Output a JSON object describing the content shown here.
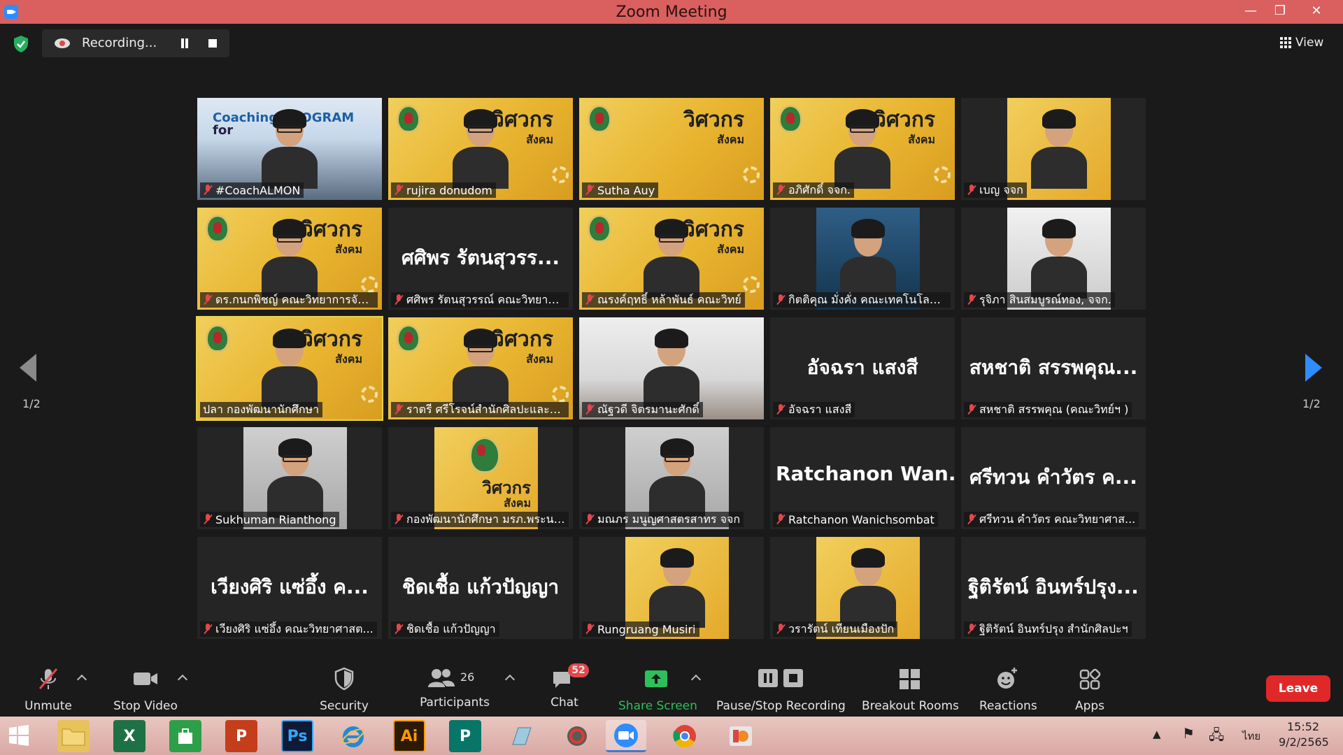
{
  "window": {
    "title": "Zoom Meeting",
    "min": "—",
    "max": "❐",
    "close": "✕"
  },
  "topbar": {
    "recording_label": "Recording...",
    "view_label": "View"
  },
  "pages": {
    "left": "1/2",
    "right": "1/2"
  },
  "participants": [
    {
      "name": "#CoachALMON",
      "style": "coach"
    },
    {
      "name": "rujira donudom",
      "style": "yellow-person"
    },
    {
      "name": "Sutha Auy",
      "style": "yellow"
    },
    {
      "name": "อภิศักดิ์ จจก.",
      "style": "yellow-person"
    },
    {
      "name": "เบญ จจก",
      "style": "inset-person"
    },
    {
      "name": "ดร.กนกพิชญ์ คณะวิทยาการจัด...",
      "style": "yellow-person"
    },
    {
      "name": "ศศิพร รัตนสุวรรณ์ คณะวิทยาศ...",
      "style": "text",
      "display": "ศศิพร รัตนสุวรร..."
    },
    {
      "name": "ณรงค์ฤทธิ์ หล้าพันธ์ คณะวิทย์",
      "style": "yellow-person"
    },
    {
      "name": "กิตติคุณ มั่งคั่ง คณะเทคโนโลยีอุ...",
      "style": "inset-blue"
    },
    {
      "name": "รุจิภา สินสมบูรณ์ทอง, จจก.",
      "style": "inset-girl"
    },
    {
      "name": "ปลา กองพัฒนานักศึกษา",
      "style": "yellow-person",
      "active": true
    },
    {
      "name": "ราตรี  ศรีโรจน์สำนักศิลปะและวั...",
      "style": "yellow-person"
    },
    {
      "name": "ณัฐวดี จิตรมานะศักดิ์",
      "style": "office"
    },
    {
      "name": "อัจฉรา แสงสี",
      "style": "text",
      "display": "อัจฉรา แสงสี"
    },
    {
      "name": "สหชาติ สรรพคุณ (คณะวิทย์ฯ )",
      "style": "text",
      "display": "สหชาติ สรรพคุณ..."
    },
    {
      "name": "Sukhuman Rianthong",
      "style": "inset-room"
    },
    {
      "name": "กองพัฒนานักศึกษา มรภ.พระนคร",
      "style": "inset-logo"
    },
    {
      "name": "มณภร มนูญศาสตรสาทร จจก",
      "style": "inset-room"
    },
    {
      "name": "Ratchanon Wanichsombat",
      "style": "text",
      "display": "Ratchanon  Wan..."
    },
    {
      "name": "ศรีทวน  คำวัตร คณะวิทยาศาส...",
      "style": "text",
      "display": "ศรีทวน  คำวัตร ค..."
    },
    {
      "name": "เวียงศิริ  แซ่อึ้ง  คณะวิทยาศาสต...",
      "style": "text",
      "display": "เวียงศิริ  แซ่อึ้ง  ค..."
    },
    {
      "name": "ชิดเชื้อ แก้วปัญญา",
      "style": "text",
      "display": "ชิดเชื้อ แก้วปัญญา"
    },
    {
      "name": "Rungruang Musiri",
      "style": "inset-person"
    },
    {
      "name": "วรารัตน์ เทียนเมืองปัก",
      "style": "inset-person"
    },
    {
      "name": "ฐิติรัตน์ อินทร์ปรุง สำนักศิลปะฯ",
      "style": "text",
      "display": "ฐิติรัตน์ อินทร์ปรุง..."
    }
  ],
  "brand": {
    "main": "วิศวกร",
    "sub": "สังคม",
    "coach_line1": "Coaching PROGRAM",
    "coach_line2": "for"
  },
  "toolbar": {
    "unmute": "Unmute",
    "stop_video": "Stop Video",
    "security": "Security",
    "participants": "Participants",
    "participants_count": "26",
    "chat": "Chat",
    "chat_badge": "52",
    "share_screen": "Share Screen",
    "pause_stop": "Pause/Stop Recording",
    "breakout": "Breakout Rooms",
    "reactions": "Reactions",
    "apps": "Apps",
    "leave": "Leave"
  },
  "taskbar": {
    "time": "15:52",
    "date": "9/2/2565",
    "lang": "ไทย",
    "apps": [
      "X",
      "P",
      "Ps",
      "Ai",
      "P"
    ]
  },
  "colors": {
    "titlebar": "#d9605f",
    "accent_blue": "#2d8cff",
    "share_green": "#2dbf5c",
    "leave_red": "#e02828",
    "active_outline": "#e7d24a"
  }
}
